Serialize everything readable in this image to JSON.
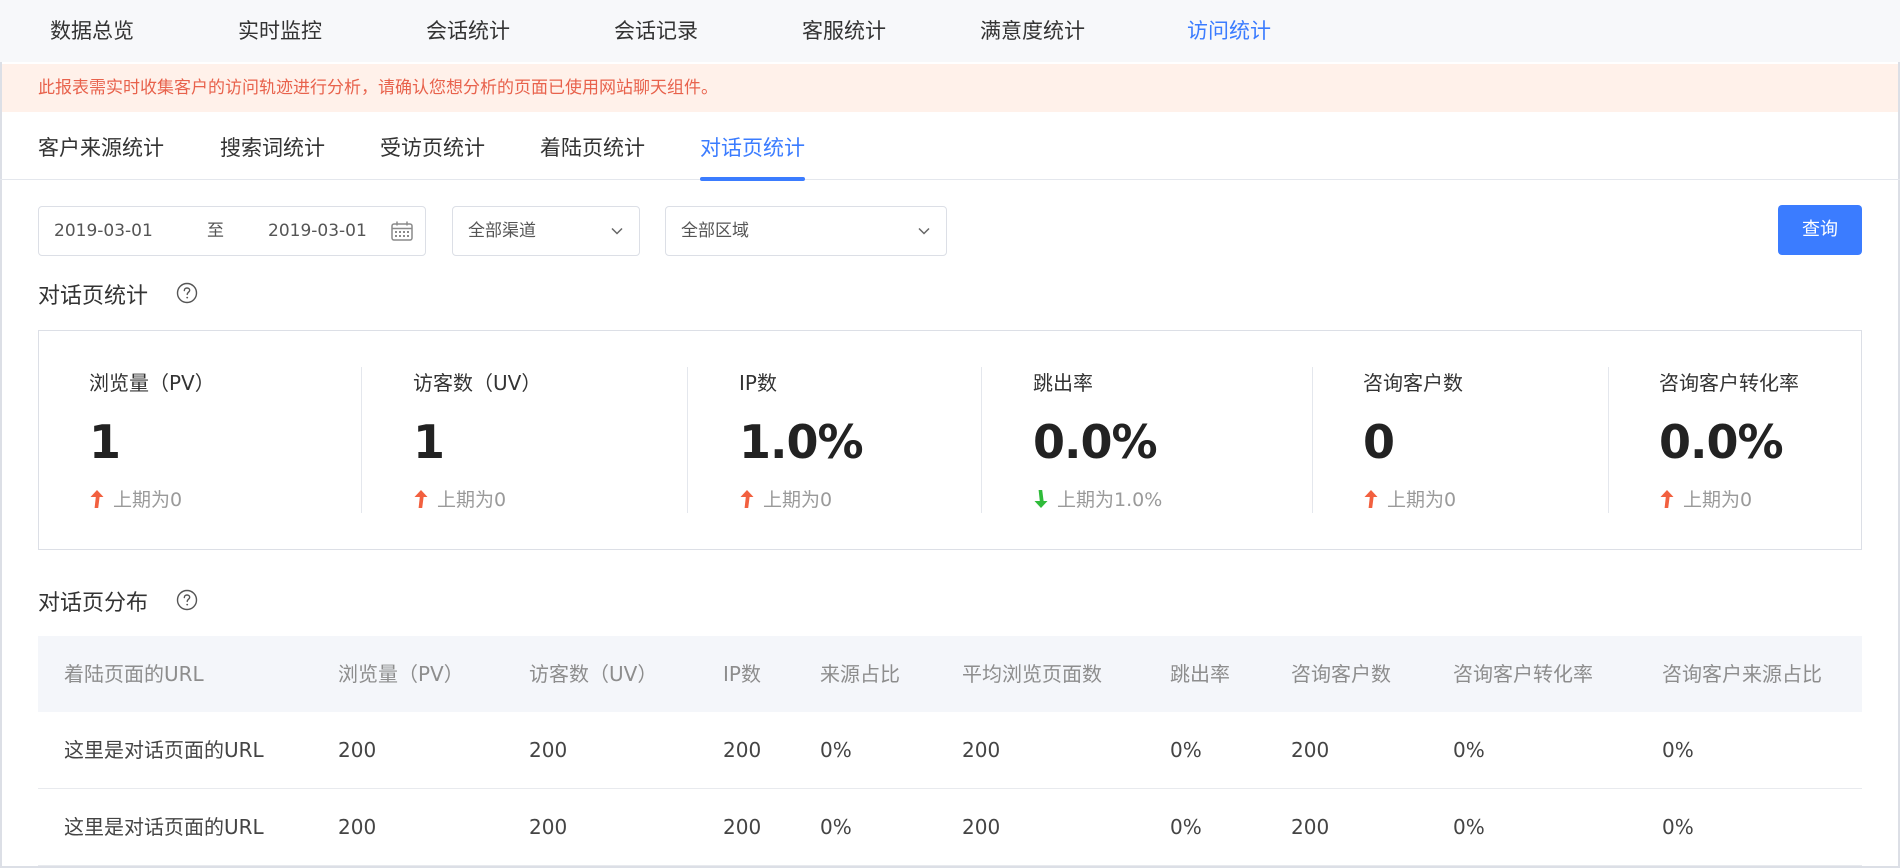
{
  "top_nav": {
    "tabs": [
      {
        "label": "数据总览"
      },
      {
        "label": "实时监控"
      },
      {
        "label": "会话统计"
      },
      {
        "label": "会话记录"
      },
      {
        "label": "客服统计"
      },
      {
        "label": "满意度统计"
      },
      {
        "label": "访问统计"
      }
    ],
    "active": "访问统计"
  },
  "notice": {
    "text": "此报表需实时收集客户的访问轨迹进行分析，请确认您想分析的页面已使用网站聊天组件。"
  },
  "sub_tabs": {
    "tabs": [
      {
        "label": "客户来源统计"
      },
      {
        "label": "搜索词统计"
      },
      {
        "label": "受访页统计"
      },
      {
        "label": "着陆页统计"
      },
      {
        "label": "对话页统计"
      }
    ],
    "active": "对话页统计"
  },
  "filters": {
    "date_start": "2019-03-01",
    "date_separator": "至",
    "date_end": "2019-03-01",
    "channel": "全部渠道",
    "region": "全部区域",
    "query_label": "查询"
  },
  "stats_section": {
    "title": "对话页统计",
    "items": [
      {
        "label": "浏览量（PV）",
        "value": "1",
        "compare": "上期为0",
        "trend": "up"
      },
      {
        "label": "访客数（UV）",
        "value": "1",
        "compare": "上期为0",
        "trend": "up"
      },
      {
        "label": "IP数",
        "value": "1.0%",
        "compare": "上期为0",
        "trend": "up"
      },
      {
        "label": "跳出率",
        "value": "0.0%",
        "compare": "上期为1.0%",
        "trend": "down"
      },
      {
        "label": "咨询客户数",
        "value": "0",
        "compare": "上期为0",
        "trend": "up"
      },
      {
        "label": "咨询客户转化率",
        "value": "0.0%",
        "compare": "上期为0",
        "trend": "up"
      }
    ]
  },
  "table_section": {
    "title": "对话页分布",
    "columns": [
      "着陆页面的URL",
      "浏览量（PV）",
      "访客数（UV）",
      "IP数",
      "来源占比",
      "平均浏览页面数",
      "跳出率",
      "咨询客户数",
      "咨询客户转化率",
      "咨询客户来源占比"
    ],
    "rows": [
      [
        "这里是对话页面的URL",
        "200",
        "200",
        "200",
        "0%",
        "200",
        "0%",
        "200",
        "0%",
        "0%"
      ],
      [
        "这里是对话页面的URL",
        "200",
        "200",
        "200",
        "0%",
        "200",
        "0%",
        "200",
        "0%",
        "0%"
      ]
    ]
  },
  "colors": {
    "accent": "#3b7cff",
    "notice_bg": "#fff1ea",
    "notice_text": "#e8624c",
    "trend_up": "#f2603f",
    "trend_down": "#2fbb3a"
  }
}
